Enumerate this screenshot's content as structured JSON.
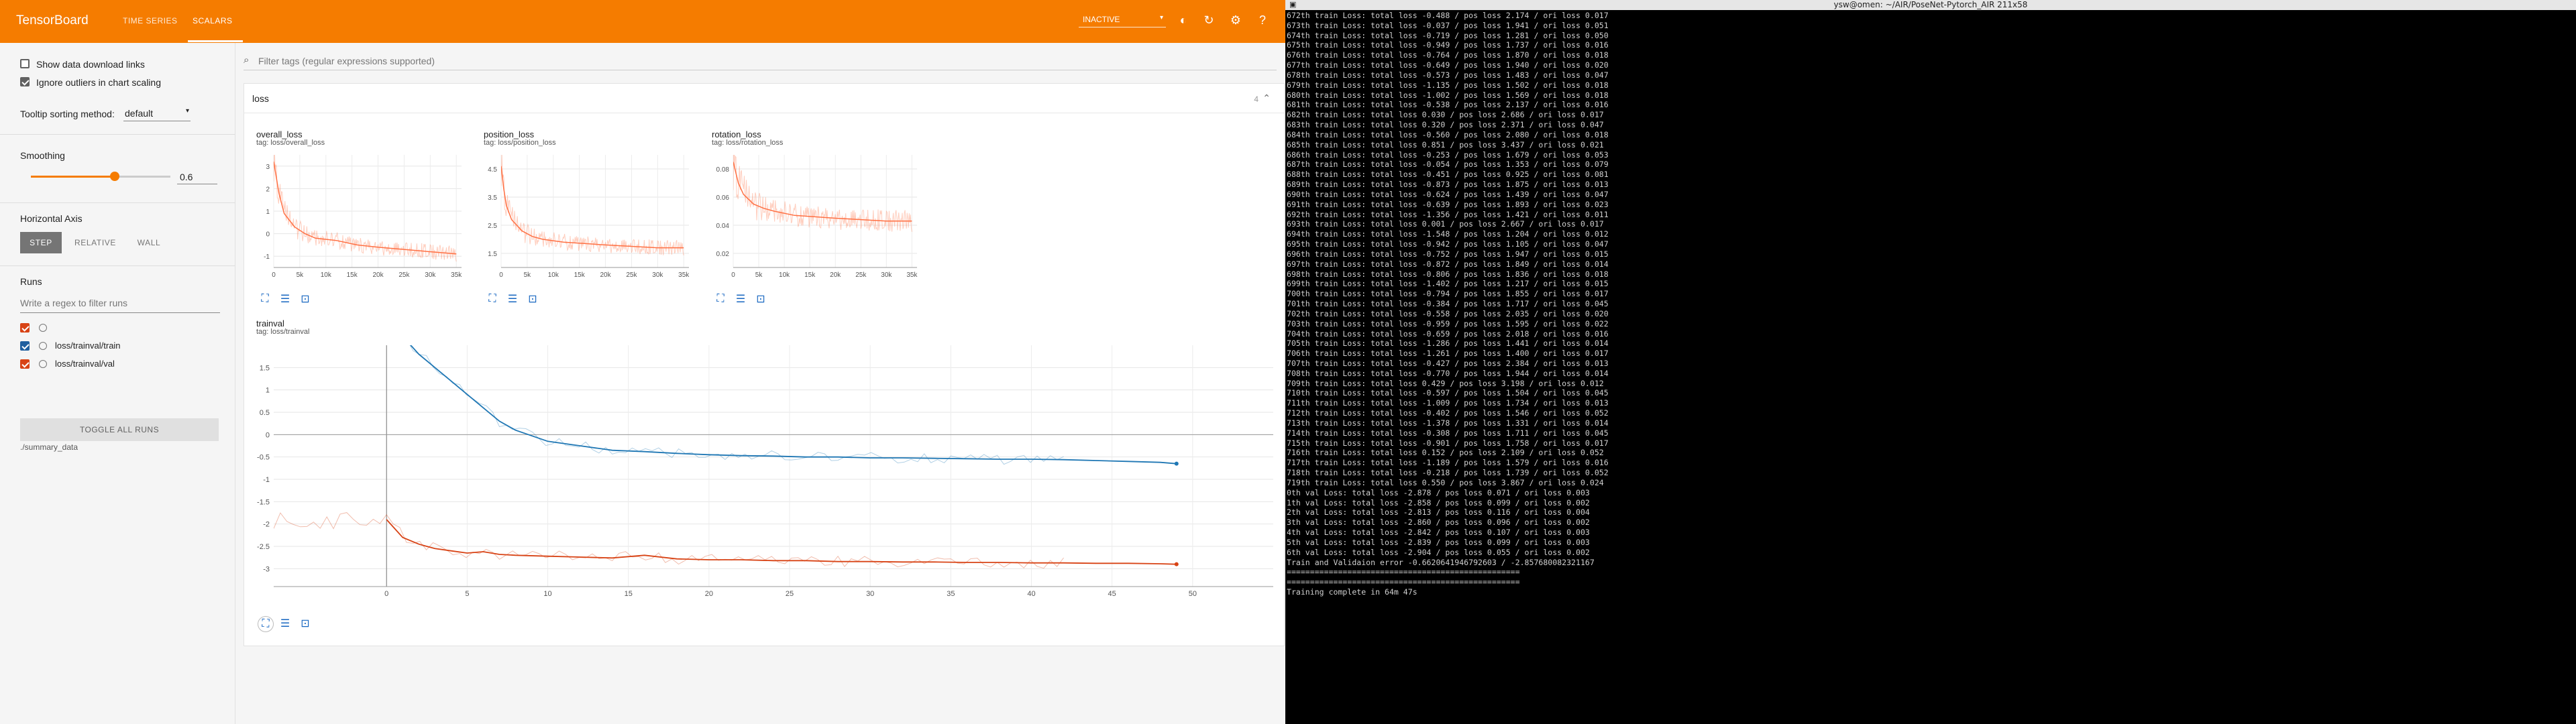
{
  "app": {
    "brand": "TensorBoard",
    "tabs": [
      {
        "label": "TIME SERIES"
      },
      {
        "label": "SCALARS"
      }
    ],
    "status_select": "INACTIVE",
    "icons": [
      "theme-toggle-icon",
      "refresh-icon",
      "settings-icon",
      "help-icon"
    ]
  },
  "sidebar": {
    "show_download": "Show data download links",
    "ignore_outliers": "Ignore outliers in chart scaling",
    "tooltip_label": "Tooltip sorting method:",
    "tooltip_value": "default",
    "smoothing_label": "Smoothing",
    "smoothing_value": "0.6",
    "smoothing_level": 0.6,
    "haxis_label": "Horizontal Axis",
    "haxis_options": [
      "STEP",
      "RELATIVE",
      "WALL"
    ],
    "runs_label": "Runs",
    "runs_filter_placeholder": "Write a regex to filter runs",
    "runs": [
      {
        "label": "",
        "checked": true
      },
      {
        "label": "loss/trainval/train",
        "checked": true
      },
      {
        "label": "loss/trainval/val",
        "checked": true
      }
    ],
    "toggle_all": "TOGGLE ALL RUNS",
    "logdir": "./summary_data"
  },
  "main": {
    "filter_placeholder": "Filter tags (regular expressions supported)",
    "group_title": "loss",
    "group_count": "4",
    "charts": [
      {
        "title": "overall_loss",
        "tag": "tag: loss/overall_loss"
      },
      {
        "title": "position_loss",
        "tag": "tag: loss/position_loss"
      },
      {
        "title": "rotation_loss",
        "tag": "tag: loss/rotation_loss"
      },
      {
        "title": "trainval",
        "tag": "tag: loss/trainval"
      }
    ]
  },
  "chart_data": [
    {
      "type": "line",
      "title": "overall_loss",
      "x_ticks": [
        "0",
        "5k",
        "10k",
        "15k",
        "20k",
        "25k",
        "30k",
        "35k"
      ],
      "y_ticks": [
        "3",
        "2",
        "1",
        "0",
        "-1"
      ],
      "xlim": [
        0,
        36000
      ],
      "ylim": [
        -1.5,
        3.5
      ],
      "series": [
        {
          "x": [
            0,
            500,
            1000,
            2000,
            4000,
            6000,
            8000,
            12000,
            16000,
            20000,
            25000,
            30000,
            35000
          ],
          "y": [
            3.2,
            2.5,
            1.8,
            0.9,
            0.3,
            0.0,
            -0.2,
            -0.3,
            -0.5,
            -0.6,
            -0.7,
            -0.8,
            -0.9
          ]
        }
      ]
    },
    {
      "type": "line",
      "title": "position_loss",
      "x_ticks": [
        "0",
        "5k",
        "10k",
        "15k",
        "20k",
        "25k",
        "30k",
        "35k"
      ],
      "y_ticks": [
        "4.5",
        "3.5",
        "2.5",
        "1.5"
      ],
      "xlim": [
        0,
        36000
      ],
      "ylim": [
        1.0,
        5.0
      ],
      "series": [
        {
          "x": [
            0,
            500,
            1000,
            2000,
            4000,
            6000,
            8000,
            12000,
            16000,
            20000,
            25000,
            30000,
            35000
          ],
          "y": [
            4.6,
            3.8,
            3.2,
            2.7,
            2.3,
            2.1,
            2.0,
            1.9,
            1.85,
            1.8,
            1.75,
            1.7,
            1.7
          ]
        }
      ]
    },
    {
      "type": "line",
      "title": "rotation_loss",
      "x_ticks": [
        "0",
        "5k",
        "10k",
        "15k",
        "20k",
        "25k",
        "30k",
        "35k"
      ],
      "y_ticks": [
        "0.08",
        "0.06",
        "0.04",
        "0.02"
      ],
      "xlim": [
        0,
        36000
      ],
      "ylim": [
        0.01,
        0.09
      ],
      "series": [
        {
          "x": [
            0,
            1000,
            2000,
            4000,
            6000,
            8000,
            12000,
            16000,
            20000,
            25000,
            30000,
            35000
          ],
          "y": [
            0.085,
            0.07,
            0.062,
            0.055,
            0.052,
            0.05,
            0.047,
            0.046,
            0.045,
            0.044,
            0.043,
            0.043
          ]
        }
      ]
    },
    {
      "type": "line",
      "title": "trainval",
      "x_ticks": [
        "0",
        "5",
        "10",
        "15",
        "20",
        "25",
        "30",
        "35",
        "40",
        "45",
        "50"
      ],
      "y_ticks": [
        "1.5",
        "1",
        "0.5",
        "0",
        "-0.5",
        "-1",
        "-1.5",
        "-2",
        "-2.5",
        "-3"
      ],
      "xlim": [
        -7,
        55
      ],
      "ylim": [
        -3.4,
        2.0
      ],
      "series": [
        {
          "name": "loss/trainval/train",
          "color": "#1f77b4",
          "x": [
            0,
            1,
            2,
            3,
            4,
            5,
            6,
            7,
            8,
            10,
            12,
            14,
            16,
            18,
            20,
            22,
            24,
            26,
            28,
            30,
            32,
            34,
            36,
            38,
            40,
            42,
            44,
            46,
            48,
            49
          ],
          "y": [
            2.6,
            2.2,
            1.8,
            1.5,
            1.2,
            0.9,
            0.6,
            0.3,
            0.1,
            -0.15,
            -0.25,
            -0.35,
            -0.38,
            -0.42,
            -0.45,
            -0.47,
            -0.48,
            -0.5,
            -0.5,
            -0.52,
            -0.52,
            -0.53,
            -0.54,
            -0.55,
            -0.55,
            -0.56,
            -0.58,
            -0.6,
            -0.62,
            -0.65
          ]
        },
        {
          "name": "loss/trainval/val",
          "color": "#d84315",
          "x": [
            0,
            1,
            2,
            3,
            4,
            5,
            6,
            7,
            8,
            10,
            12,
            14,
            16,
            18,
            20,
            22,
            24,
            26,
            28,
            30,
            32,
            34,
            36,
            38,
            40,
            42,
            44,
            46,
            48,
            49
          ],
          "y": [
            -1.9,
            -2.3,
            -2.45,
            -2.55,
            -2.6,
            -2.65,
            -2.62,
            -2.68,
            -2.7,
            -2.72,
            -2.74,
            -2.76,
            -2.7,
            -2.78,
            -2.8,
            -2.8,
            -2.82,
            -2.82,
            -2.84,
            -2.84,
            -2.85,
            -2.85,
            -2.86,
            -2.86,
            -2.87,
            -2.87,
            -2.88,
            -2.88,
            -2.89,
            -2.9
          ]
        }
      ]
    }
  ],
  "terminal": {
    "title": "ysw@omen: ~/AIR/PoseNet-Pytorch_AIR 211x58",
    "lines": [
      "672th train Loss: total loss -0.488 / pos loss 2.174 / ori loss 0.017",
      "673th train Loss: total loss -0.037 / pos loss 1.941 / ori loss 0.051",
      "674th train Loss: total loss -0.719 / pos loss 1.281 / ori loss 0.050",
      "675th train Loss: total loss -0.949 / pos loss 1.737 / ori loss 0.016",
      "676th train Loss: total loss -0.764 / pos loss 1.870 / ori loss 0.018",
      "677th train Loss: total loss -0.649 / pos loss 1.940 / ori loss 0.020",
      "678th train Loss: total loss -0.573 / pos loss 1.483 / ori loss 0.047",
      "679th train Loss: total loss -1.135 / pos loss 1.502 / ori loss 0.018",
      "680th train Loss: total loss -1.002 / pos loss 1.569 / ori loss 0.018",
      "681th train Loss: total loss -0.538 / pos loss 2.137 / ori loss 0.016",
      "682th train Loss: total loss 0.030 / pos loss 2.686 / ori loss 0.017",
      "683th train Loss: total loss 0.320 / pos loss 2.371 / ori loss 0.047",
      "684th train Loss: total loss -0.560 / pos loss 2.080 / ori loss 0.018",
      "685th train Loss: total loss 0.851 / pos loss 3.437 / ori loss 0.021",
      "686th train Loss: total loss -0.253 / pos loss 1.679 / ori loss 0.053",
      "687th train Loss: total loss -0.054 / pos loss 1.353 / ori loss 0.079",
      "688th train Loss: total loss -0.451 / pos loss 0.925 / ori loss 0.081",
      "689th train Loss: total loss -0.873 / pos loss 1.875 / ori loss 0.013",
      "690th train Loss: total loss -0.624 / pos loss 1.439 / ori loss 0.047",
      "691th train Loss: total loss -0.639 / pos loss 1.893 / ori loss 0.023",
      "692th train Loss: total loss -1.356 / pos loss 1.421 / ori loss 0.011",
      "693th train Loss: total loss 0.001 / pos loss 2.667 / ori loss 0.017",
      "694th train Loss: total loss -1.548 / pos loss 1.204 / ori loss 0.012",
      "695th train Loss: total loss -0.942 / pos loss 1.105 / ori loss 0.047",
      "696th train Loss: total loss -0.752 / pos loss 1.947 / ori loss 0.015",
      "697th train Loss: total loss -0.872 / pos loss 1.849 / ori loss 0.014",
      "698th train Loss: total loss -0.806 / pos loss 1.836 / ori loss 0.018",
      "699th train Loss: total loss -1.402 / pos loss 1.217 / ori loss 0.015",
      "700th train Loss: total loss -0.794 / pos loss 1.855 / ori loss 0.017",
      "701th train Loss: total loss -0.384 / pos loss 1.717 / ori loss 0.045",
      "702th train Loss: total loss -0.558 / pos loss 2.035 / ori loss 0.020",
      "703th train Loss: total loss -0.959 / pos loss 1.595 / ori loss 0.022",
      "704th train Loss: total loss -0.659 / pos loss 2.018 / ori loss 0.016",
      "705th train Loss: total loss -1.286 / pos loss 1.441 / ori loss 0.014",
      "706th train Loss: total loss -1.261 / pos loss 1.400 / ori loss 0.017",
      "707th train Loss: total loss -0.427 / pos loss 2.384 / ori loss 0.013",
      "708th train Loss: total loss -0.770 / pos loss 1.944 / ori loss 0.014",
      "709th train Loss: total loss 0.429 / pos loss 3.198 / ori loss 0.012",
      "710th train Loss: total loss -0.597 / pos loss 1.504 / ori loss 0.045",
      "711th train Loss: total loss -1.009 / pos loss 1.734 / ori loss 0.013",
      "712th train Loss: total loss -0.402 / pos loss 1.546 / ori loss 0.052",
      "713th train Loss: total loss -1.378 / pos loss 1.331 / ori loss 0.014",
      "714th train Loss: total loss -0.308 / pos loss 1.711 / ori loss 0.045",
      "715th train Loss: total loss -0.901 / pos loss 1.758 / ori loss 0.017",
      "716th train Loss: total loss 0.152 / pos loss 2.109 / ori loss 0.052",
      "717th train Loss: total loss -1.189 / pos loss 1.579 / ori loss 0.016",
      "718th train Loss: total loss -0.218 / pos loss 1.739 / ori loss 0.052",
      "719th train Loss: total loss 0.550 / pos loss 3.867 / ori loss 0.024",
      "0th val Loss: total loss -2.878 / pos loss 0.071 / ori loss 0.003",
      "1th val Loss: total loss -2.858 / pos loss 0.099 / ori loss 0.002",
      "2th val Loss: total loss -2.813 / pos loss 0.116 / ori loss 0.004",
      "3th val Loss: total loss -2.860 / pos loss 0.096 / ori loss 0.002",
      "4th val Loss: total loss -2.842 / pos loss 0.107 / ori loss 0.003",
      "5th val Loss: total loss -2.839 / pos loss 0.099 / ori loss 0.003",
      "6th val Loss: total loss -2.904 / pos loss 0.055 / ori loss 0.002",
      "Train and Validaion error -0.6620641946792603 / -2.857680082321167",
      "==================================================",
      "==================================================",
      "Training complete in 64m 47s"
    ]
  }
}
